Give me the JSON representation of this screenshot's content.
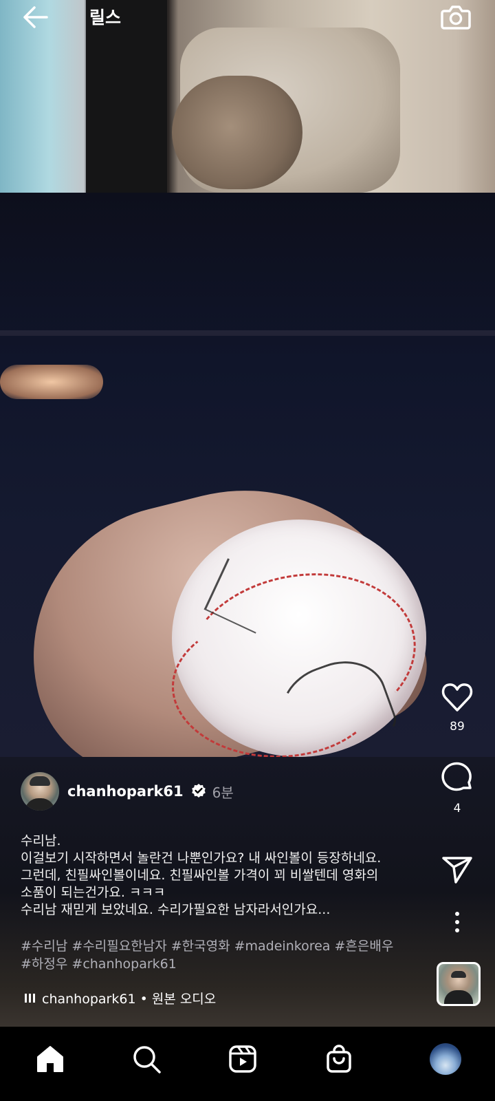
{
  "header": {
    "title": "릴스"
  },
  "actions": {
    "like_count": "89",
    "comment_count": "4"
  },
  "post": {
    "username": "chanhopark61",
    "time_ago": "6분",
    "caption_lines": [
      "수리남.",
      "이걸보기 시작하면서 놀란건 나뿐인가요? 내 싸인볼이 등장하네요.",
      "그런데,  친필싸인볼이네요.  친필싸인볼 가격이 꾀 비쌀텐데 영화의",
      "소품이 되는건가요. ㅋㅋㅋ",
      "수리남 재믿게 보았네요.  수리가필요한 남자라서인가요..."
    ],
    "hashtag_lines": [
      "#수리남 #수리필요한남자 #한국영화 #madeinkorea #흔은배우",
      "#하정우 #chanhopark61"
    ],
    "audio_label": "chanhopark61 • 원본 오디오"
  },
  "icons": {
    "back": "arrow-left-icon",
    "camera": "camera-icon",
    "like": "heart-icon",
    "comment": "comment-icon",
    "share": "paper-plane-icon",
    "more": "more-vertical-icon",
    "verified": "verified-badge-icon",
    "home": "home-icon",
    "search": "search-icon",
    "reels": "reels-icon",
    "shop": "shop-bag-icon"
  },
  "colors": {
    "background": "#000000",
    "muted_text": "#a0a0a8",
    "hashtag_text": "#b0b0b8",
    "verified_badge": "#ffffff"
  }
}
